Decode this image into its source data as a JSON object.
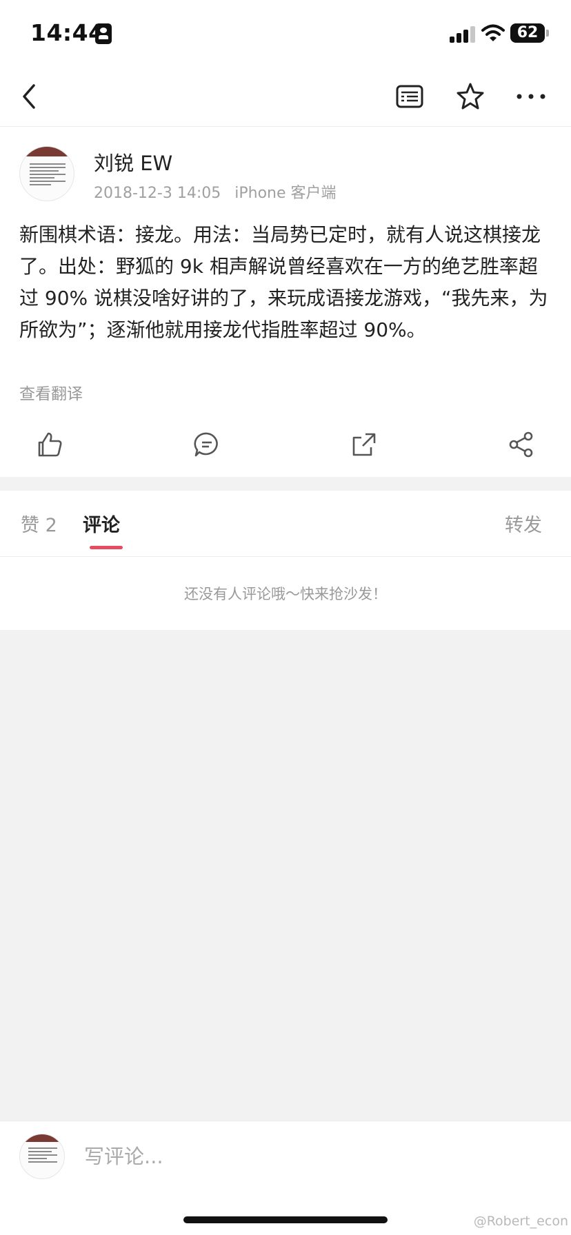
{
  "status_bar": {
    "time": "14:44",
    "battery": "62",
    "icons": [
      "contact-card-icon",
      "cellular-signal-icon",
      "wifi-icon",
      "battery-icon"
    ]
  },
  "nav": {
    "icons": [
      "back-chevron-icon",
      "reader-mode-icon",
      "star-icon",
      "more-icon"
    ]
  },
  "post": {
    "author": "刘锐 EW",
    "date": "2018-12-3 14:05",
    "source": "iPhone 客户端",
    "text": "新围棋术语：接龙。用法：当局势已定时，就有人说这棋接龙了。出处：野狐的 9k 相声解说曾经喜欢在一方的绝艺胜率超过 90% 说棋没啥好讲的了，来玩成语接龙游戏，“我先来，为所欲为”；逐渐他就用接龙代指胜率超过 90%。",
    "translate_label": "查看翻译",
    "actions": [
      "like-icon",
      "comment-icon",
      "repost-icon",
      "share-icon"
    ]
  },
  "tabs": {
    "likes": "赞 2",
    "comments": "评论",
    "reposts": "转发",
    "active": "comments",
    "accent_color": "#e84a5f"
  },
  "comments": {
    "empty_text": "还没有人评论哦～快来抢沙发！"
  },
  "bottom_bar": {
    "placeholder": "写评论...",
    "watermark": "@Robert_econ"
  }
}
